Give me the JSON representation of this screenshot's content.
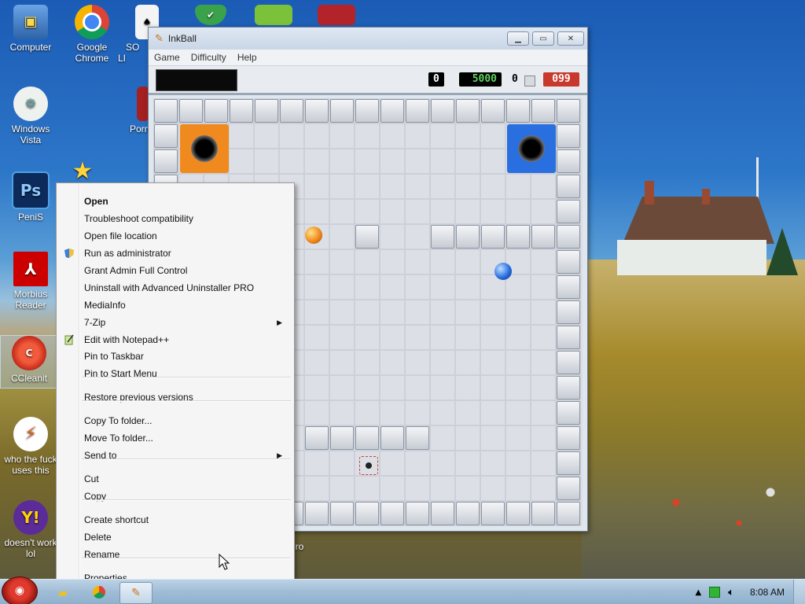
{
  "desktop": {
    "icons": [
      {
        "label": "Computer"
      },
      {
        "label": "Google Chrome"
      },
      {
        "label": "SO LI"
      },
      {
        "label": "Windows Vista"
      },
      {
        "label": "Porn"
      },
      {
        "label": "PeniS"
      },
      {
        "label": "Morbius Reader"
      },
      {
        "label": "CCleanit"
      },
      {
        "label": "who the fuck uses this"
      },
      {
        "label": "doesn't work lol"
      },
      {
        "label": "ro"
      }
    ]
  },
  "inkball": {
    "title": "InkBall",
    "menu": [
      "Game",
      "Difficulty",
      "Help"
    ],
    "scores": {
      "balls_captured": "0",
      "points": "5000",
      "balls_remaining": "0",
      "timer": "099"
    },
    "colors": {
      "points": "#5fd35f",
      "timer_bg": "#c8382c",
      "orange_hole": "#f08a1f",
      "blue_hole": "#2a6fe0"
    }
  },
  "context_menu": {
    "items": [
      {
        "label": "Open",
        "bold": true
      },
      {
        "label": "Troubleshoot compatibility"
      },
      {
        "label": "Open file location"
      },
      {
        "label": "Run as administrator",
        "icon": "shield-icon"
      },
      {
        "label": "Grant Admin Full Control"
      },
      {
        "label": "Uninstall with Advanced Uninstaller PRO"
      },
      {
        "label": "MediaInfo"
      },
      {
        "label": "7-Zip",
        "submenu": true
      },
      {
        "label": "Edit with Notepad++",
        "icon": "notepad-icon"
      },
      {
        "label": "Pin to Taskbar"
      },
      {
        "label": "Pin to Start Menu"
      },
      {
        "label": "Restore previous versions"
      },
      {
        "label": "Copy To folder..."
      },
      {
        "label": "Move To folder..."
      },
      {
        "label": "Send to",
        "submenu": true
      },
      {
        "label": "Cut"
      },
      {
        "label": "Copy"
      },
      {
        "label": "Create shortcut"
      },
      {
        "label": "Delete"
      },
      {
        "label": "Rename"
      },
      {
        "label": "Properties"
      }
    ]
  },
  "taskbar": {
    "clock": "8:08 AM"
  }
}
